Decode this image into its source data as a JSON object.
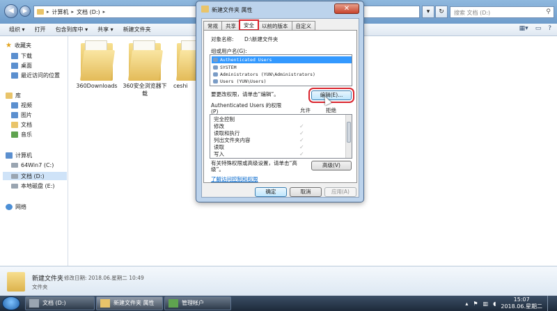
{
  "address": {
    "crumbs": [
      "计算机",
      "文档 (D:)"
    ],
    "search_placeholder": "搜索 文档 (D:)"
  },
  "toolbar": {
    "items": [
      "组织 ▾",
      "打开",
      "包含到库中 ▾",
      "共享 ▾",
      "新建文件夹"
    ]
  },
  "nav": {
    "favorites": "收藏夹",
    "downloads": "下载",
    "desktop": "桌面",
    "recent": "最近访问的位置",
    "libraries": "库",
    "videos": "视频",
    "pictures": "图片",
    "documents": "文档",
    "music": "音乐",
    "computer": "计算机",
    "drive_c": "64Win7  (C:)",
    "drive_d": "文档 (D:)",
    "drive_e": "本地磁盘 (E:)",
    "network": "网络"
  },
  "folders": [
    "360Downloads",
    "360安全浏览器下\n载",
    "ceshi"
  ],
  "details": {
    "name": "新建文件夹",
    "date": "修改日期: 2018.06.星期二 10:49",
    "type": "文件夹"
  },
  "dialog": {
    "title": "新建文件夹 属性",
    "tabs": [
      "常规",
      "共享",
      "安全",
      "以前的版本",
      "自定义"
    ],
    "object_label": "对象名称:",
    "object_value": "D:\\新建文件夹",
    "group_label": "组或用户名(G):",
    "users": [
      "Authenticated Users",
      "SYSTEM",
      "Administrators (YUN\\Administrators)",
      "Users (YUN\\Users)"
    ],
    "edit_hint": "要更改权限，请单击“编辑”。",
    "edit_button": "编辑(E)...",
    "perm_label": "Authenticated Users 的权限\n(P)",
    "allow": "允许",
    "deny": "拒绝",
    "permissions": [
      "完全控制",
      "修改",
      "读取和执行",
      "列出文件夹内容",
      "读取",
      "写入"
    ],
    "allowed": [
      false,
      true,
      true,
      true,
      true,
      true
    ],
    "special_hint": "有关特殊权限或高级设置，请单击“高\n级”。",
    "advanced_button": "高级(V)",
    "learn_link": "了解访问控制和权限",
    "ok": "确定",
    "cancel": "取消",
    "apply": "应用(A)"
  },
  "taskbar": {
    "tasks": [
      "文档 (D:)",
      "新建文件夹 属性",
      "管理帐户"
    ],
    "time": "15:07",
    "date": "2018.06.星期二"
  }
}
